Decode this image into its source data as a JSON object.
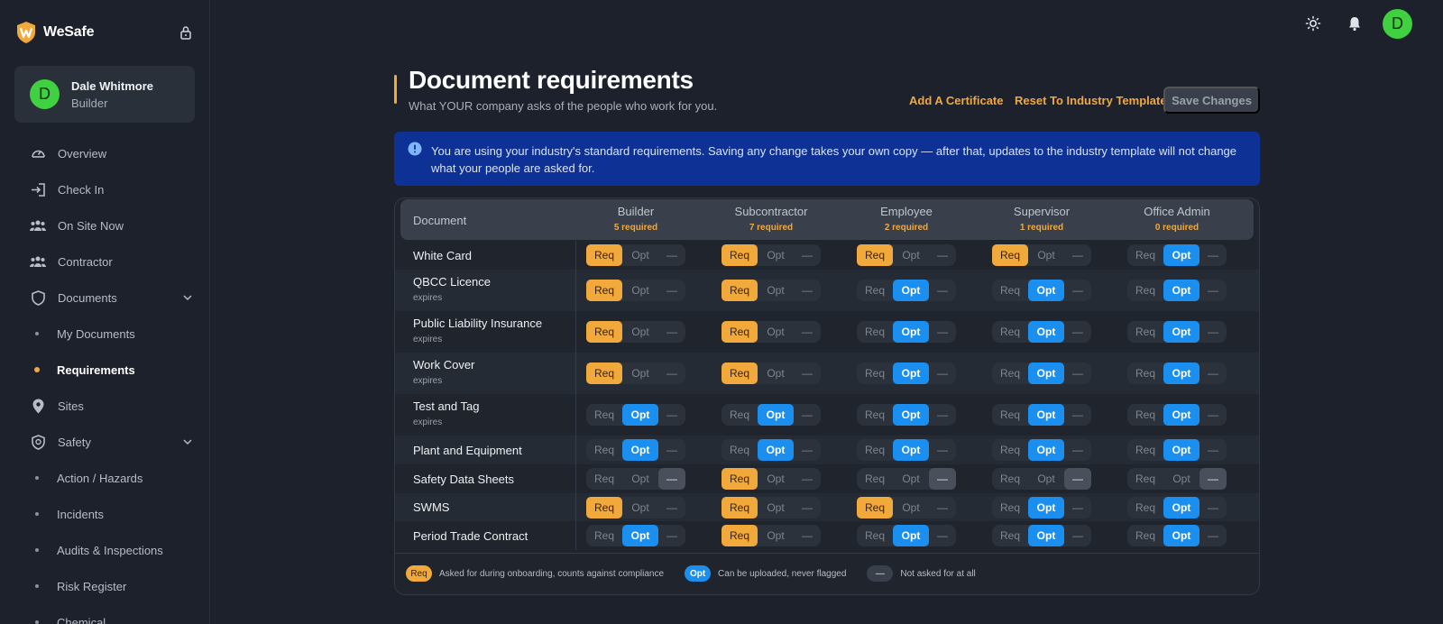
{
  "brand": {
    "name": "WeSafe"
  },
  "user": {
    "initial": "D",
    "name": "Dale Whitmore",
    "role": "Builder"
  },
  "nav": {
    "overview": "Overview",
    "check_in": "Check In",
    "on_site_now": "On Site Now",
    "contractor": "Contractor",
    "documents": "Documents",
    "my_documents": "My Documents",
    "requirements": "Requirements",
    "sites": "Sites",
    "safety": "Safety",
    "action_hazards": "Action / Hazards",
    "incidents": "Incidents",
    "audits": "Audits & Inspections",
    "risk_register": "Risk Register",
    "chemical": "Chemical"
  },
  "header": {
    "title": "Document requirements",
    "subtitle": "What YOUR company asks of the people who work for you.",
    "add_certificate": "Add A Certificate",
    "reset_template": "Reset To Industry Template",
    "save_changes": "Save Changes"
  },
  "banner": {
    "text": "You are using your industry's standard requirements. Saving any change takes your own copy — after that, updates to the industry template will not change what your people are asked for."
  },
  "table": {
    "doc_header": "Document",
    "columns": [
      {
        "role": "Builder",
        "required": "5 required"
      },
      {
        "role": "Subcontractor",
        "required": "7 required"
      },
      {
        "role": "Employee",
        "required": "2 required"
      },
      {
        "role": "Supervisor",
        "required": "1 required"
      },
      {
        "role": "Office Admin",
        "required": "0 required"
      }
    ],
    "option_labels": {
      "req": "Req",
      "opt": "Opt",
      "na": "—"
    },
    "rows": [
      {
        "name": "White Card",
        "expires": "",
        "values": [
          "req",
          "req",
          "req",
          "req",
          "opt"
        ]
      },
      {
        "name": "QBCC Licence",
        "expires": "expires",
        "values": [
          "req",
          "req",
          "opt",
          "opt",
          "opt"
        ]
      },
      {
        "name": "Public Liability Insurance",
        "expires": "expires",
        "values": [
          "req",
          "req",
          "opt",
          "opt",
          "opt"
        ]
      },
      {
        "name": "Work Cover",
        "expires": "expires",
        "values": [
          "req",
          "req",
          "opt",
          "opt",
          "opt"
        ]
      },
      {
        "name": "Test and Tag",
        "expires": "expires",
        "values": [
          "opt",
          "opt",
          "opt",
          "opt",
          "opt"
        ]
      },
      {
        "name": "Plant and Equipment",
        "expires": "",
        "values": [
          "opt",
          "opt",
          "opt",
          "opt",
          "opt"
        ]
      },
      {
        "name": "Safety Data Sheets",
        "expires": "",
        "values": [
          "na",
          "req",
          "na",
          "na",
          "na"
        ]
      },
      {
        "name": "SWMS",
        "expires": "",
        "values": [
          "req",
          "req",
          "req",
          "opt",
          "opt"
        ]
      },
      {
        "name": "Period Trade Contract",
        "expires": "",
        "values": [
          "opt",
          "req",
          "opt",
          "opt",
          "opt"
        ]
      }
    ]
  },
  "legend": {
    "req_badge": "Req",
    "req_text": "Asked for during onboarding, counts against compliance",
    "opt_badge": "Opt",
    "opt_text": "Can be uploaded, never flagged",
    "na_badge": "—",
    "na_text": "Not asked for at all"
  },
  "colors": {
    "accent": "#f2a93b",
    "opt_blue": "#1a8ff0",
    "banner": "#0d3195",
    "avatar_green": "#3fd13f"
  },
  "icons": {
    "top": [
      "sun-icon",
      "bell-icon"
    ],
    "nav": [
      "gauge-icon",
      "login-icon",
      "users-icon",
      "users-icon",
      "shield-icon",
      "pin-icon",
      "shield-icon"
    ]
  }
}
